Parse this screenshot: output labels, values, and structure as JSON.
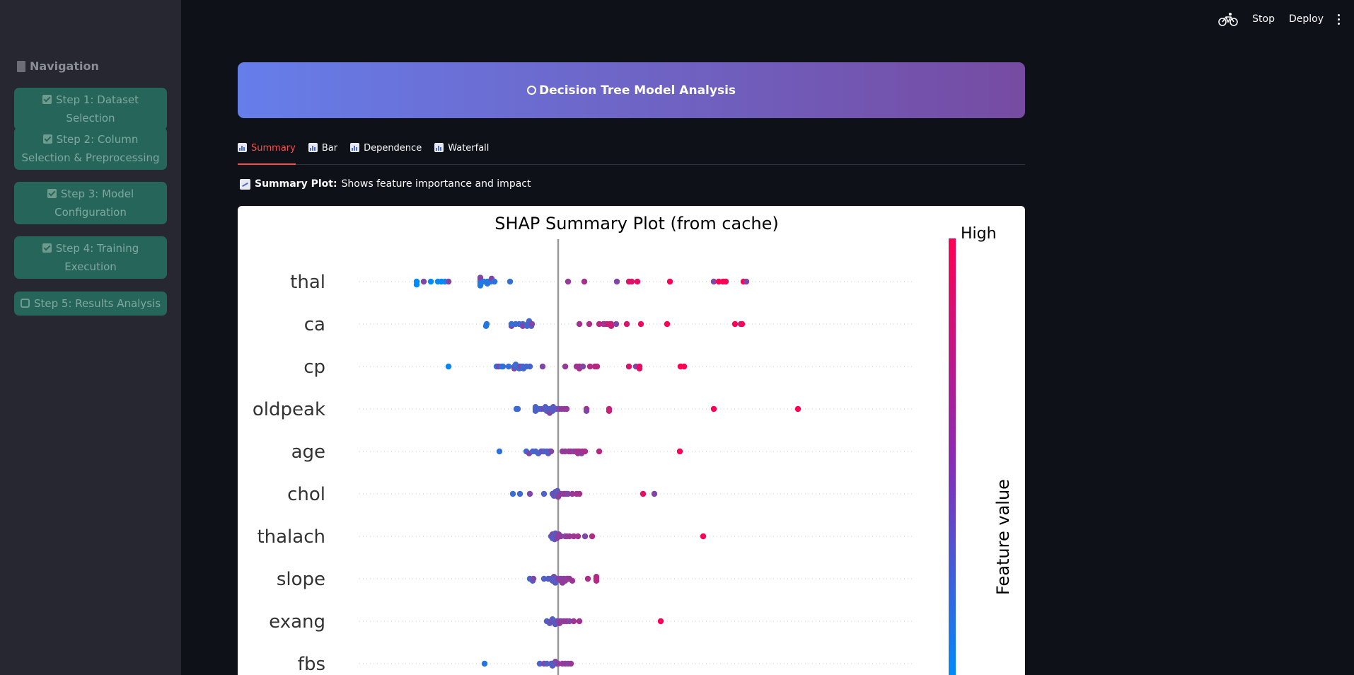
{
  "topbar": {
    "stop_label": "Stop",
    "deploy_label": "Deploy"
  },
  "sidebar": {
    "title": "Navigation",
    "steps": [
      {
        "label": "Step 1: Dataset Selection",
        "status": "done"
      },
      {
        "label": "Step 2: Column Selection & Preprocessing",
        "status": "done"
      },
      {
        "label": "Step 3: Model Configuration",
        "status": "done"
      },
      {
        "label": "Step 4: Training Execution",
        "status": "done"
      },
      {
        "label": "Step 5: Results Analysis",
        "status": "current"
      }
    ]
  },
  "header": {
    "title": "Decision Tree Model Analysis"
  },
  "tabs": [
    {
      "label": "Summary",
      "active": true
    },
    {
      "label": "Bar",
      "active": false
    },
    {
      "label": "Dependence",
      "active": false
    },
    {
      "label": "Waterfall",
      "active": false
    }
  ],
  "caption": {
    "bold": "Summary Plot:",
    "text": "Shows feature importance and impact"
  },
  "colors": {
    "low": "#008bfb",
    "high": "#ff0052",
    "accent": "#ff4b4b"
  },
  "chart_data": {
    "type": "scatter",
    "subtype": "shap-beeswarm",
    "title": "SHAP Summary Plot (from cache)",
    "colorbar": {
      "label": "Feature value",
      "high_label": "High"
    },
    "features": [
      {
        "name": "thal",
        "points": [
          [
            -0.2,
            0.0
          ],
          [
            -0.2,
            0.3
          ],
          [
            -0.19,
            0.0
          ],
          [
            -0.18,
            0.0
          ],
          [
            -0.17,
            0.0
          ],
          [
            -0.165,
            0.0
          ],
          [
            -0.16,
            0.0
          ],
          [
            -0.155,
            0.0
          ],
          [
            -0.11,
            0.0
          ],
          [
            -0.11,
            -0.2
          ],
          [
            -0.11,
            0.2
          ],
          [
            -0.11,
            0.4
          ],
          [
            -0.11,
            -0.4
          ],
          [
            -0.105,
            0.0
          ],
          [
            -0.1,
            0.0
          ],
          [
            -0.1,
            0.2
          ],
          [
            -0.095,
            0.0
          ],
          [
            -0.094,
            -0.3
          ],
          [
            -0.09,
            0.0
          ],
          [
            -0.068,
            0.0
          ],
          [
            0.014,
            0.0
          ],
          [
            0.037,
            0.0
          ],
          [
            0.083,
            0.0
          ],
          [
            0.1,
            0.0
          ],
          [
            0.104,
            0.0
          ],
          [
            0.112,
            0.0
          ],
          [
            0.158,
            0.0
          ],
          [
            0.22,
            0.0
          ],
          [
            0.227,
            0.0
          ],
          [
            0.233,
            0.0
          ],
          [
            0.237,
            0.0
          ],
          [
            0.262,
            0.0
          ],
          [
            0.266,
            0.0
          ]
        ]
      },
      {
        "name": "ca",
        "points": [
          [
            -0.102,
            0.2
          ],
          [
            -0.101,
            0.0
          ],
          [
            -0.066,
            0.2
          ],
          [
            -0.066,
            0.0
          ],
          [
            -0.06,
            0.0
          ],
          [
            -0.055,
            0.0
          ],
          [
            -0.05,
            0.0
          ],
          [
            -0.05,
            0.2
          ],
          [
            -0.044,
            0.2
          ],
          [
            -0.043,
            0.0
          ],
          [
            -0.041,
            -0.3
          ],
          [
            -0.038,
            0.2
          ],
          [
            -0.037,
            0.0
          ],
          [
            0.03,
            0.0
          ],
          [
            0.044,
            0.0
          ],
          [
            0.058,
            0.0
          ],
          [
            0.064,
            0.0
          ],
          [
            0.066,
            0.0
          ],
          [
            0.069,
            0.0
          ],
          [
            0.073,
            0.0
          ],
          [
            0.075,
            0.0
          ],
          [
            0.075,
            0.2
          ],
          [
            0.082,
            0.0
          ],
          [
            0.097,
            0.0
          ],
          [
            0.117,
            0.0
          ],
          [
            0.154,
            0.0
          ],
          [
            0.25,
            0.0
          ],
          [
            0.258,
            0.0
          ],
          [
            0.26,
            0.0
          ]
        ]
      },
      {
        "name": "cp",
        "points": [
          [
            -0.155,
            0.0
          ],
          [
            -0.087,
            0.0
          ],
          [
            -0.084,
            0.0
          ],
          [
            -0.08,
            0.0
          ],
          [
            -0.078,
            0.0
          ],
          [
            -0.07,
            0.0
          ],
          [
            -0.062,
            0.0
          ],
          [
            -0.062,
            0.2
          ],
          [
            -0.06,
            0.0
          ],
          [
            -0.06,
            -0.2
          ],
          [
            -0.055,
            0.2
          ],
          [
            -0.055,
            0.0
          ],
          [
            -0.053,
            0.0
          ],
          [
            -0.05,
            0.0
          ],
          [
            -0.049,
            0.2
          ],
          [
            -0.045,
            0.0
          ],
          [
            -0.04,
            0.0
          ],
          [
            -0.022,
            0.0
          ],
          [
            0.01,
            0.0
          ],
          [
            0.026,
            0.0
          ],
          [
            0.03,
            0.0
          ],
          [
            0.03,
            0.2
          ],
          [
            0.035,
            0.0
          ],
          [
            0.045,
            0.0
          ],
          [
            0.052,
            0.0
          ],
          [
            0.055,
            0.0
          ],
          [
            0.1,
            0.0
          ],
          [
            0.11,
            0.0
          ],
          [
            0.115,
            0.0
          ],
          [
            0.115,
            0.2
          ],
          [
            0.173,
            0.0
          ],
          [
            0.178,
            0.0
          ]
        ]
      },
      {
        "name": "oldpeak",
        "points": [
          [
            -0.059,
            0.0
          ],
          [
            -0.057,
            0.0
          ],
          [
            -0.032,
            0.0
          ],
          [
            -0.032,
            -0.2
          ],
          [
            -0.032,
            0.2
          ],
          [
            -0.028,
            0.0
          ],
          [
            -0.024,
            0.0
          ],
          [
            -0.02,
            0.0
          ],
          [
            -0.018,
            0.0
          ],
          [
            -0.018,
            -0.2
          ],
          [
            -0.016,
            0.2
          ],
          [
            -0.012,
            0.0
          ],
          [
            -0.012,
            0.4
          ],
          [
            -0.008,
            0.2
          ],
          [
            -0.007,
            -0.2
          ],
          [
            -0.005,
            0.0
          ],
          [
            -0.003,
            0.0
          ],
          [
            0.001,
            0.0
          ],
          [
            0.005,
            0.0
          ],
          [
            0.009,
            0.0
          ],
          [
            0.012,
            0.0
          ],
          [
            0.04,
            0.0
          ],
          [
            0.04,
            0.2
          ],
          [
            0.072,
            0.0
          ],
          [
            0.072,
            0.2
          ],
          [
            0.22,
            0.0
          ],
          [
            0.339,
            0.0
          ]
        ]
      },
      {
        "name": "age",
        "points": [
          [
            -0.083,
            0.0
          ],
          [
            -0.045,
            0.0
          ],
          [
            -0.041,
            0.2
          ],
          [
            -0.036,
            0.0
          ],
          [
            -0.032,
            0.0
          ],
          [
            -0.028,
            0.2
          ],
          [
            -0.024,
            0.0
          ],
          [
            -0.022,
            0.0
          ],
          [
            -0.02,
            0.0
          ],
          [
            -0.016,
            0.0
          ],
          [
            -0.014,
            0.2
          ],
          [
            -0.012,
            0.0
          ],
          [
            -0.01,
            0.0
          ],
          [
            0.006,
            0.0
          ],
          [
            0.01,
            0.0
          ],
          [
            0.015,
            0.0
          ],
          [
            0.018,
            0.0
          ],
          [
            0.022,
            0.0
          ],
          [
            0.025,
            0.0
          ],
          [
            0.028,
            0.0
          ],
          [
            0.028,
            0.2
          ],
          [
            0.03,
            0.0
          ],
          [
            0.033,
            0.2
          ],
          [
            0.034,
            0.0
          ],
          [
            0.038,
            0.0
          ],
          [
            0.058,
            0.0
          ],
          [
            0.172,
            0.0
          ]
        ]
      },
      {
        "name": "chol",
        "points": [
          [
            -0.064,
            0.0
          ],
          [
            -0.054,
            0.0
          ],
          [
            -0.04,
            0.0
          ],
          [
            -0.02,
            0.0
          ],
          [
            -0.008,
            0.0
          ],
          [
            -0.006,
            0.2
          ],
          [
            -0.004,
            -0.2
          ],
          [
            -0.004,
            0.0
          ],
          [
            -0.002,
            0.0
          ],
          [
            -0.002,
            0.2
          ],
          [
            -0.001,
            -0.3
          ],
          [
            0.0,
            0.3
          ],
          [
            0.002,
            0.0
          ],
          [
            0.004,
            0.0
          ],
          [
            0.008,
            0.0
          ],
          [
            0.01,
            0.0
          ],
          [
            0.012,
            0.0
          ],
          [
            0.014,
            0.0
          ],
          [
            0.02,
            0.0
          ],
          [
            0.026,
            0.0
          ],
          [
            0.03,
            0.0
          ],
          [
            0.12,
            0.0
          ],
          [
            0.136,
            0.0
          ]
        ]
      },
      {
        "name": "thalach",
        "points": [
          [
            -0.01,
            0.0
          ],
          [
            -0.008,
            0.2
          ],
          [
            -0.008,
            -0.2
          ],
          [
            -0.006,
            0.0
          ],
          [
            -0.005,
            0.3
          ],
          [
            -0.004,
            -0.3
          ],
          [
            -0.002,
            0.0
          ],
          [
            -0.002,
            0.2
          ],
          [
            0.0,
            0.0
          ],
          [
            0.001,
            -0.2
          ],
          [
            0.002,
            0.0
          ],
          [
            0.004,
            0.0
          ],
          [
            0.01,
            0.0
          ],
          [
            0.012,
            0.0
          ],
          [
            0.016,
            0.0
          ],
          [
            0.022,
            0.0
          ],
          [
            0.028,
            0.0
          ],
          [
            0.038,
            0.0
          ],
          [
            0.048,
            0.0
          ],
          [
            0.205,
            0.0
          ]
        ]
      },
      {
        "name": "slope",
        "points": [
          [
            -0.04,
            0.0
          ],
          [
            -0.036,
            0.2
          ],
          [
            -0.035,
            0.0
          ],
          [
            -0.02,
            0.0
          ],
          [
            -0.014,
            0.0
          ],
          [
            -0.01,
            0.0
          ],
          [
            -0.008,
            0.2
          ],
          [
            -0.006,
            -0.2
          ],
          [
            -0.005,
            0.0
          ],
          [
            -0.004,
            0.4
          ],
          [
            -0.003,
            0.2
          ],
          [
            0.0,
            0.0
          ],
          [
            0.004,
            0.0
          ],
          [
            0.004,
            0.2
          ],
          [
            0.006,
            0.4
          ],
          [
            0.008,
            0.0
          ],
          [
            0.01,
            0.2
          ],
          [
            0.012,
            0.0
          ],
          [
            0.014,
            0.0
          ],
          [
            0.016,
            0.0
          ],
          [
            0.02,
            0.2
          ],
          [
            0.042,
            0.0
          ],
          [
            0.054,
            0.0
          ],
          [
            0.054,
            0.2
          ],
          [
            0.054,
            -0.2
          ]
        ]
      },
      {
        "name": "exang",
        "points": [
          [
            -0.016,
            0.0
          ],
          [
            -0.012,
            0.2
          ],
          [
            -0.01,
            0.0
          ],
          [
            -0.008,
            -0.2
          ],
          [
            -0.006,
            0.0
          ],
          [
            -0.004,
            0.3
          ],
          [
            -0.002,
            0.0
          ],
          [
            0.0,
            0.0
          ],
          [
            0.002,
            0.2
          ],
          [
            0.004,
            0.0
          ],
          [
            0.008,
            0.0
          ],
          [
            0.012,
            0.0
          ],
          [
            0.016,
            0.0
          ],
          [
            0.022,
            0.0
          ],
          [
            0.03,
            0.0
          ],
          [
            0.145,
            0.0
          ]
        ]
      },
      {
        "name": "fbs",
        "points": [
          [
            -0.104,
            0.0
          ],
          [
            -0.026,
            0.0
          ],
          [
            -0.02,
            0.0
          ],
          [
            -0.016,
            0.0
          ],
          [
            -0.01,
            0.0
          ],
          [
            -0.008,
            0.2
          ],
          [
            -0.006,
            0.0
          ],
          [
            -0.004,
            -0.2
          ],
          [
            -0.002,
            0.0
          ],
          [
            0.0,
            0.0
          ],
          [
            0.006,
            0.0
          ],
          [
            0.01,
            0.0
          ],
          [
            0.014,
            0.0
          ],
          [
            0.018,
            0.0
          ]
        ]
      }
    ]
  }
}
